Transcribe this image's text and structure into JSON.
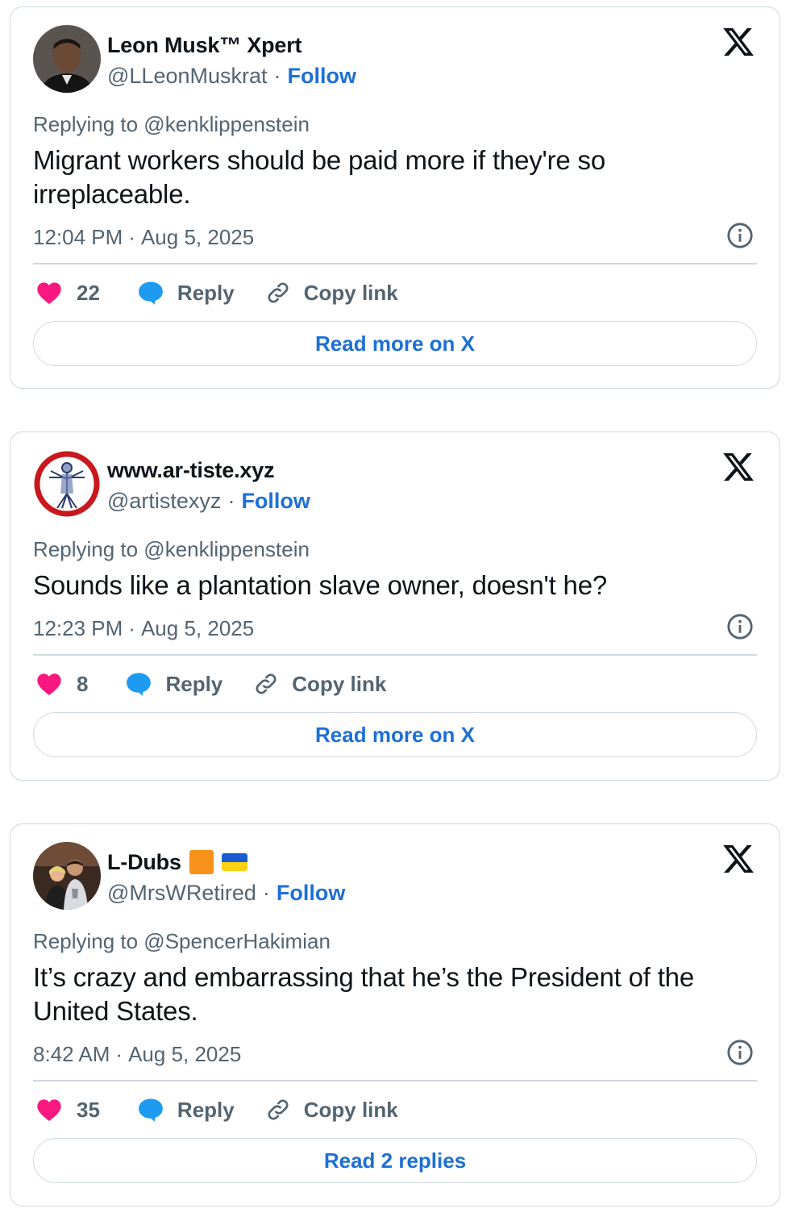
{
  "brand": {
    "x_icon": "x-logo",
    "link_color": "#1d6fd6",
    "like_color": "#f91880",
    "reply_color": "#1d9bf0"
  },
  "tweets": [
    {
      "display_name": "Leon Musk™ Xpert",
      "handle": "@LLeonMuskrat",
      "separator": "·",
      "follow": "Follow",
      "replying_to": "Replying to @kenklippenstein",
      "text": "Migrant workers should be paid more if they're so irreplaceable.",
      "time": "12:04 PM",
      "date": "Aug 5, 2025",
      "likes": "22",
      "reply": "Reply",
      "copy_link": "Copy link",
      "read_more": "Read more on X"
    },
    {
      "display_name": "www.ar-tiste.xyz",
      "handle": "@artistexyz",
      "separator": "·",
      "follow": "Follow",
      "replying_to": "Replying to @kenklippenstein",
      "text": "Sounds like a plantation slave owner, doesn't he?",
      "time": "12:23 PM",
      "date": "Aug 5, 2025",
      "likes": "8",
      "reply": "Reply",
      "copy_link": "Copy link",
      "read_more": "Read more on X"
    },
    {
      "display_name": "L-Dubs",
      "handle": "@MrsWRetired",
      "separator": "·",
      "follow": "Follow",
      "replying_to": "Replying to @SpencerHakimian",
      "text": "It’s crazy and embarrassing that he’s the President of the United States.",
      "time": "8:42 AM",
      "date": "Aug 5, 2025",
      "likes": "35",
      "reply": "Reply",
      "copy_link": "Copy link",
      "read_more": "Read 2 replies"
    }
  ]
}
